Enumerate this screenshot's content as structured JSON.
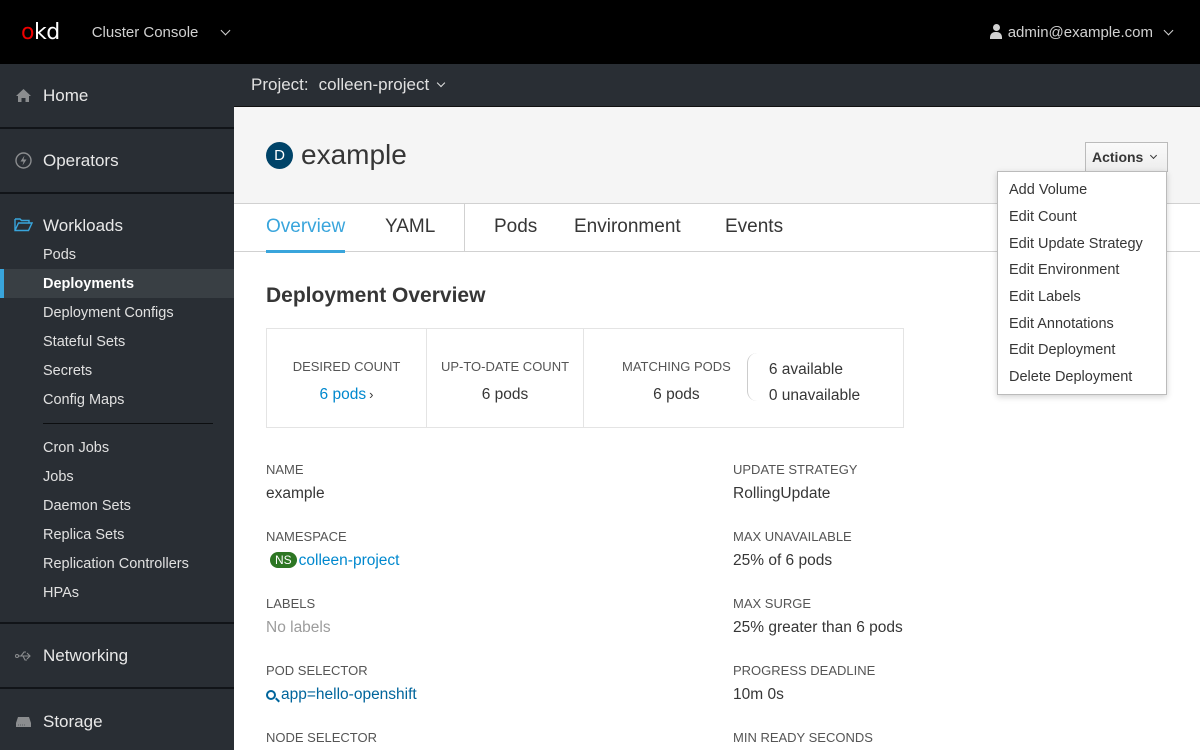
{
  "masthead": {
    "logo": {
      "o": "o",
      "rest": "kd"
    },
    "console_switcher": "Cluster Console",
    "user": "admin@example.com"
  },
  "sidebar": {
    "sections_top": [
      {
        "label": "Home",
        "icon": "home-icon"
      },
      {
        "label": "Operators",
        "icon": "bolt-icon"
      }
    ],
    "workloads": {
      "label": "Workloads",
      "icon": "folder-open-icon",
      "items": [
        {
          "label": "Pods",
          "active": false
        },
        {
          "label": "Deployments",
          "active": true
        },
        {
          "label": "Deployment Configs",
          "active": false
        },
        {
          "label": "Stateful Sets",
          "active": false
        },
        {
          "label": "Secrets",
          "active": false
        },
        {
          "label": "Config Maps",
          "active": false
        }
      ],
      "items_after_divider": [
        {
          "label": "Cron Jobs"
        },
        {
          "label": "Jobs"
        },
        {
          "label": "Daemon Sets"
        },
        {
          "label": "Replica Sets"
        },
        {
          "label": "Replication Controllers"
        },
        {
          "label": "HPAs"
        }
      ]
    },
    "sections_bottom": [
      {
        "label": "Networking",
        "icon": "network-icon"
      },
      {
        "label": "Storage",
        "icon": "storage-icon"
      }
    ]
  },
  "project_bar": {
    "label": "Project:",
    "project": "colleen-project"
  },
  "page_header": {
    "kind_badge": "D",
    "title": "example",
    "actions_label": "Actions"
  },
  "tabs": [
    {
      "label": "Overview",
      "active": true
    },
    {
      "label": "YAML",
      "active": false
    },
    {
      "label": "Pods",
      "active": false
    },
    {
      "label": "Environment",
      "active": false
    },
    {
      "label": "Events",
      "active": false
    }
  ],
  "actions_menu": [
    "Add Volume",
    "Edit Count",
    "Edit Update Strategy",
    "Edit Environment",
    "Edit Labels",
    "Edit Annotations",
    "Edit Deployment",
    "Delete Deployment"
  ],
  "overview": {
    "title": "Deployment Overview",
    "stats": {
      "desired_count": {
        "label": "DESIRED COUNT",
        "value": "6 pods"
      },
      "up_to_date": {
        "label": "UP-TO-DATE COUNT",
        "value": "6 pods"
      },
      "matching": {
        "label": "MATCHING PODS",
        "value": "6 pods",
        "available": "6 available",
        "unavailable": "0 unavailable"
      }
    },
    "details_left": {
      "name": {
        "label": "NAME",
        "value": "example"
      },
      "namespace": {
        "label": "NAMESPACE",
        "badge": "NS",
        "value": "colleen-project"
      },
      "labels": {
        "label": "LABELS",
        "value": "No labels"
      },
      "pod_selector": {
        "label": "POD SELECTOR",
        "value": "app=hello-openshift"
      },
      "node_selector": {
        "label": "NODE SELECTOR"
      }
    },
    "details_right": {
      "update_strategy": {
        "label": "UPDATE STRATEGY",
        "value": "RollingUpdate"
      },
      "max_unavailable": {
        "label": "MAX UNAVAILABLE",
        "value": "25% of 6 pods"
      },
      "max_surge": {
        "label": "MAX SURGE",
        "value": "25% greater than 6 pods"
      },
      "progress_deadline": {
        "label": "PROGRESS DEADLINE",
        "value": "10m 0s"
      },
      "min_ready": {
        "label": "MIN READY SECONDS"
      }
    }
  },
  "colors": {
    "accent": "#39a5dc",
    "link": "#0088ce",
    "masthead_bg": "#000000",
    "sidebar_bg": "#292e34",
    "ns_badge": "#2d7623",
    "deployment_badge": "#004368"
  }
}
